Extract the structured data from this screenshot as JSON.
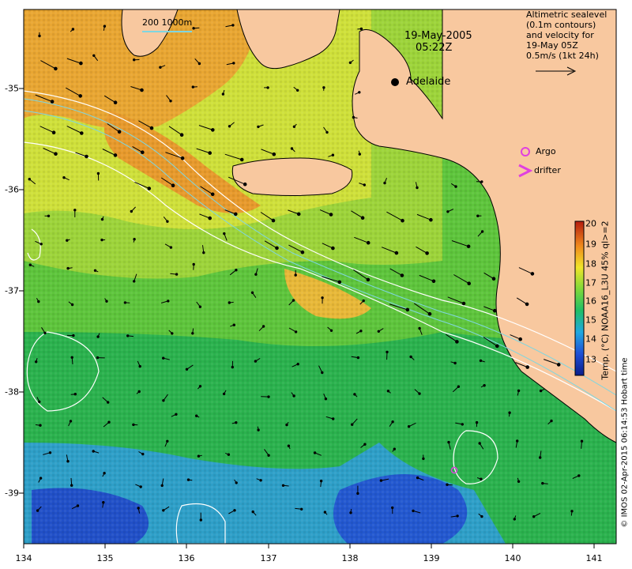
{
  "map": {
    "date_line": "19-May-2005",
    "time_line": "05:22Z",
    "scale_bar": "200  1000m",
    "legend_lines": [
      "Altimetric sealevel",
      "(0.1m contours)",
      "and velocity for",
      "19-May 05Z",
      "0.5m/s (1kt 24h)"
    ],
    "city": "Adelaide",
    "argo_label": "Argo",
    "drifter_label": "drifter",
    "colorbar_title": "Temp. (°C) NOAA16_L3U 45% ql>=2",
    "colorbar_ticks": [
      "20",
      "19",
      "18",
      "17",
      "16",
      "15",
      "14",
      "13"
    ],
    "credit": "© IMOS 02-Apr-2015 06:14:53 Hobart time",
    "x_ticks": [
      "134",
      "135",
      "136",
      "137",
      "138",
      "139",
      "140",
      "141"
    ],
    "y_ticks": [
      "-35",
      "-36",
      "-37",
      "-38",
      "-39"
    ],
    "colors": {
      "land": "#f8c89f",
      "warm": "#e8902a",
      "mid": "#9bd63a",
      "cool": "#19b24a",
      "cold": "#2a6ed6",
      "contour": "#ffffff",
      "marker": "#e040e0"
    }
  }
}
